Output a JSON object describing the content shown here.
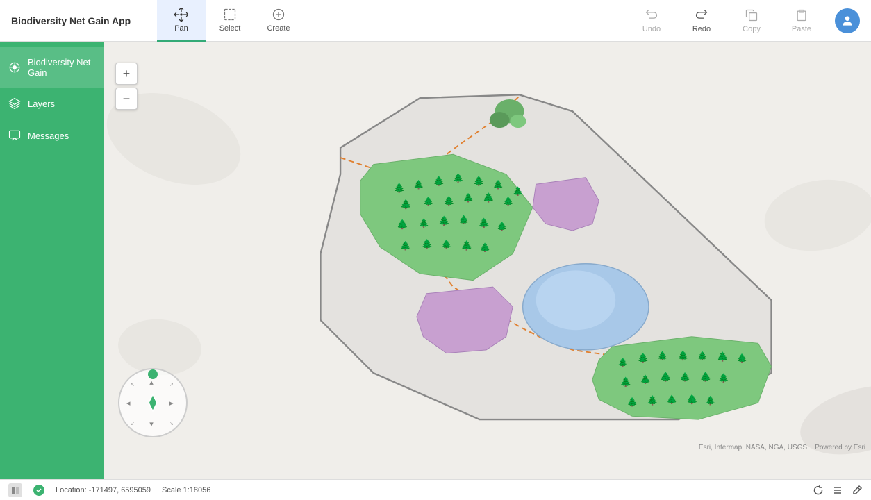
{
  "app": {
    "title": "Biodiversity Net Gain App"
  },
  "toolbar": {
    "tools": [
      {
        "id": "pan",
        "label": "Pan",
        "active": true
      },
      {
        "id": "select",
        "label": "Select",
        "active": false
      },
      {
        "id": "create",
        "label": "Create",
        "active": false
      }
    ],
    "actions": [
      {
        "id": "undo",
        "label": "Undo",
        "enabled": false
      },
      {
        "id": "redo",
        "label": "Redo",
        "enabled": true
      },
      {
        "id": "copy",
        "label": "Copy",
        "enabled": false
      },
      {
        "id": "paste",
        "label": "Paste",
        "enabled": false
      }
    ]
  },
  "sidebar": {
    "items": [
      {
        "id": "bng",
        "label": "Biodiversity Net Gain",
        "active": true
      },
      {
        "id": "layers",
        "label": "Layers",
        "active": false
      },
      {
        "id": "messages",
        "label": "Messages",
        "active": false
      }
    ]
  },
  "map": {
    "location_label": "Location: -171497, 6595059",
    "scale_label": "Scale 1:18056",
    "attribution": "Esri, Intermap, NASA, NGA, USGS",
    "attribution2": "Powered by Esri"
  },
  "status_bar": {
    "location": "Location: -171497, 6595059",
    "scale": "Scale 1:18056"
  }
}
